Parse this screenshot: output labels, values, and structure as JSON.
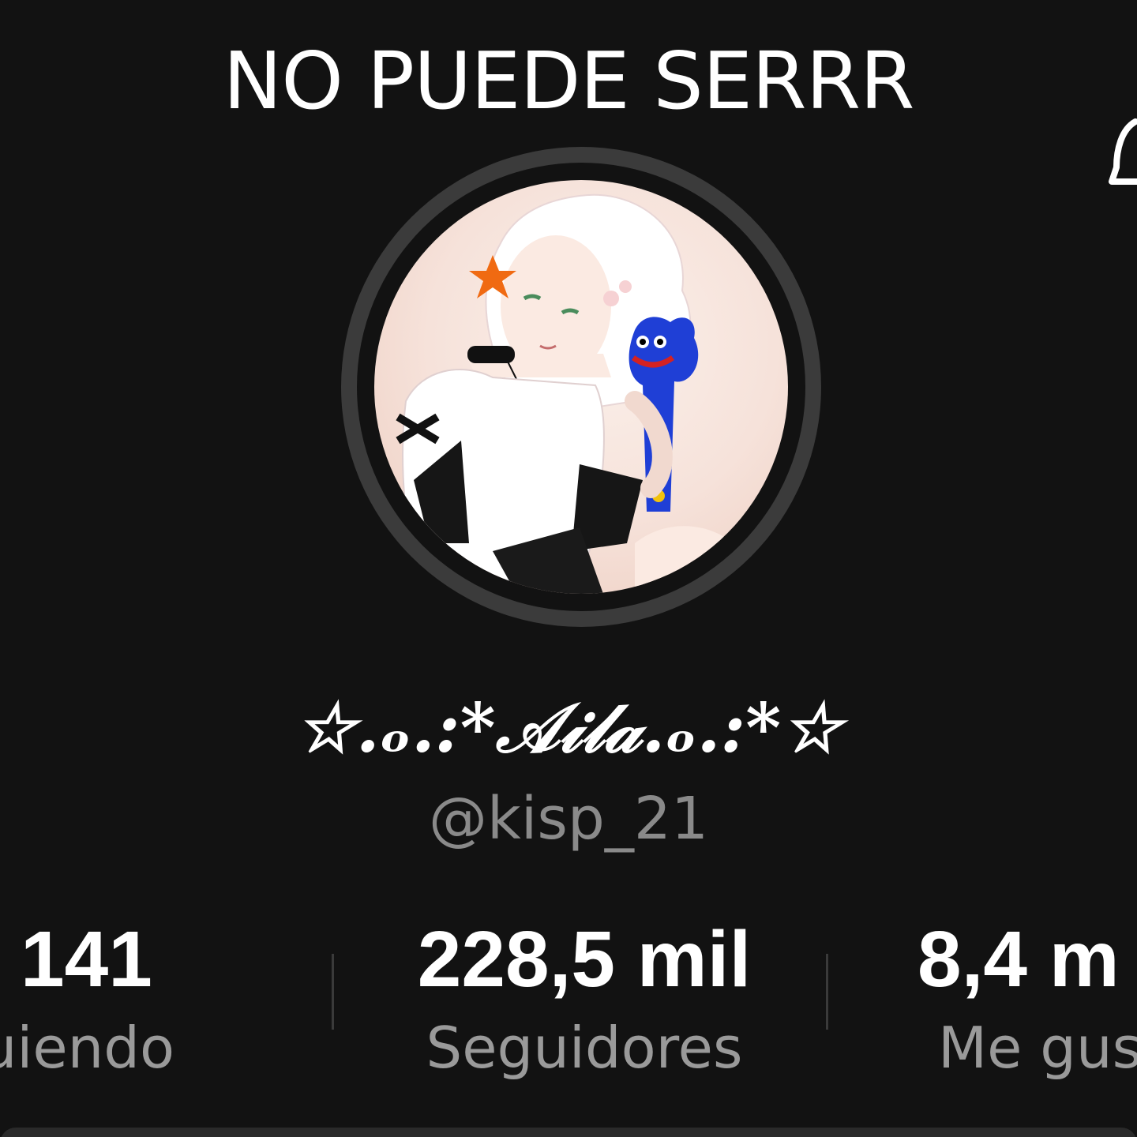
{
  "overlay": {
    "caption": "NO PUEDE SERRR"
  },
  "profile": {
    "display_name": "☆.ₒ.:*𝒜𝒾𝓁𝒶.ₒ.:*☆",
    "username": "@kisp_21",
    "avatar_icon": "profile-avatar-illustration"
  },
  "stats": {
    "following": {
      "value": "141",
      "label": "guiendo"
    },
    "followers": {
      "value": "228,5 mil",
      "label": "Seguidores"
    },
    "likes": {
      "value": "8,4 m",
      "label": "Me gus"
    }
  },
  "colors": {
    "background": "#121212",
    "ring": "#3b3b3b",
    "muted_text": "#8a8a8a"
  }
}
